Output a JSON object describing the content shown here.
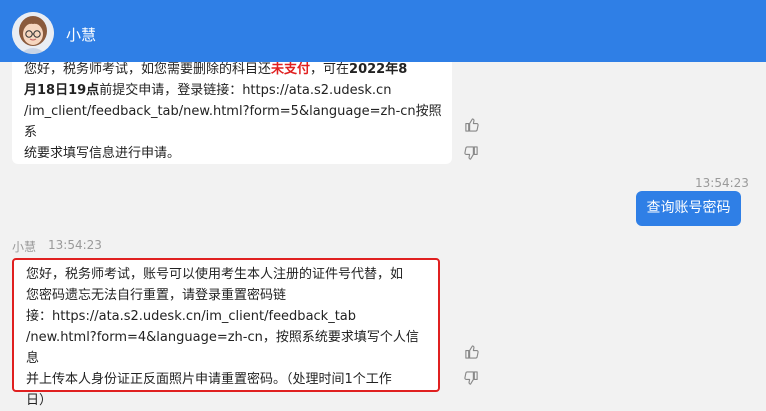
{
  "header": {
    "agent_name": "小慧"
  },
  "messages": [
    {
      "from": "agent",
      "lines": [
        [
          {
            "t": "您好，税务师考试，如您需要删除的科目还"
          },
          {
            "t": "未支付",
            "style": "red"
          },
          {
            "t": "，可在"
          },
          {
            "t": "2022年8",
            "style": "bold"
          }
        ],
        [
          {
            "t": "月18日19点",
            "style": "bold"
          },
          {
            "t": "前提交申请，登录链接：https://ata.s2.udesk.cn"
          }
        ],
        [
          {
            "t": "/im_client/feedback_tab/new.html?form=5&language=zh-cn按照系"
          }
        ],
        [
          {
            "t": "统要求填写信息进行申请。"
          }
        ]
      ]
    },
    {
      "from": "user",
      "time": "13:54:23",
      "text": "查询账号密码"
    },
    {
      "from": "agent",
      "sender": "小慧",
      "time": "13:54:23",
      "lines": [
        "您好，税务师考试，账号可以使用考生本人注册的证件号代替，如",
        "您密码遗忘无法自行重置，请登录重置密码链",
        "接：https://ata.s2.udesk.cn/im_client/feedback_tab",
        "/new.html?form=4&language=zh-cn，按照系统要求填写个人信息",
        "并上传本人身份证正反面照片申请重置密码。（处理时间1个工作",
        "日）"
      ]
    }
  ],
  "icons": {
    "like": "thumbs-up-icon",
    "dislike": "thumbs-down-icon",
    "avatar": "agent-avatar"
  },
  "colors": {
    "header": "#2f7fe6",
    "user_bubble": "#2f7fe6",
    "highlight_border": "#e02020",
    "accent_red": "#e02020"
  }
}
